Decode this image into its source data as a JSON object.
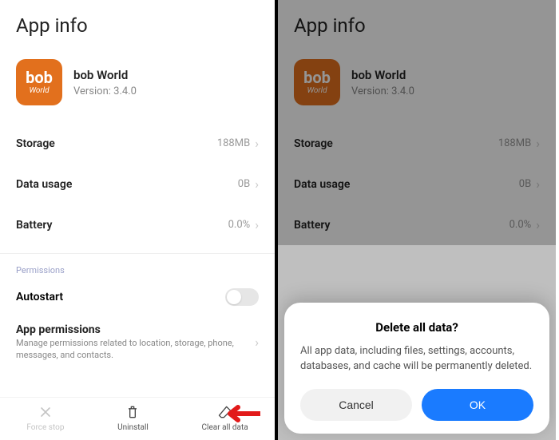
{
  "left": {
    "header": "App info",
    "app": {
      "icon_top": "bob",
      "icon_bottom": "World",
      "name": "bob World",
      "version": "Version: 3.4.0"
    },
    "rows": {
      "storage": {
        "label": "Storage",
        "value": "188MB"
      },
      "datausage": {
        "label": "Data usage",
        "value": "0B"
      },
      "battery": {
        "label": "Battery",
        "value": "0.0%"
      }
    },
    "permissions_section": "Permissions",
    "autostart": {
      "label": "Autostart"
    },
    "app_permissions": {
      "title": "App permissions",
      "desc": "Manage permissions related to location, storage, phone, messages, and contacts."
    },
    "bottom": {
      "force_stop": "Force stop",
      "uninstall": "Uninstall",
      "clear_all": "Clear all data"
    }
  },
  "right": {
    "header": "App info",
    "app": {
      "icon_top": "bob",
      "icon_bottom": "World",
      "name": "bob World",
      "version": "Version: 3.4.0"
    },
    "rows": {
      "storage": {
        "label": "Storage",
        "value": "188MB"
      },
      "datausage": {
        "label": "Data usage",
        "value": "0B"
      },
      "battery": {
        "label": "Battery",
        "value": "0.0%"
      }
    },
    "dialog": {
      "title": "Delete all data?",
      "body": "All app data, including files, settings, accounts, databases, and cache will be permanently deleted.",
      "cancel": "Cancel",
      "ok": "OK"
    }
  }
}
